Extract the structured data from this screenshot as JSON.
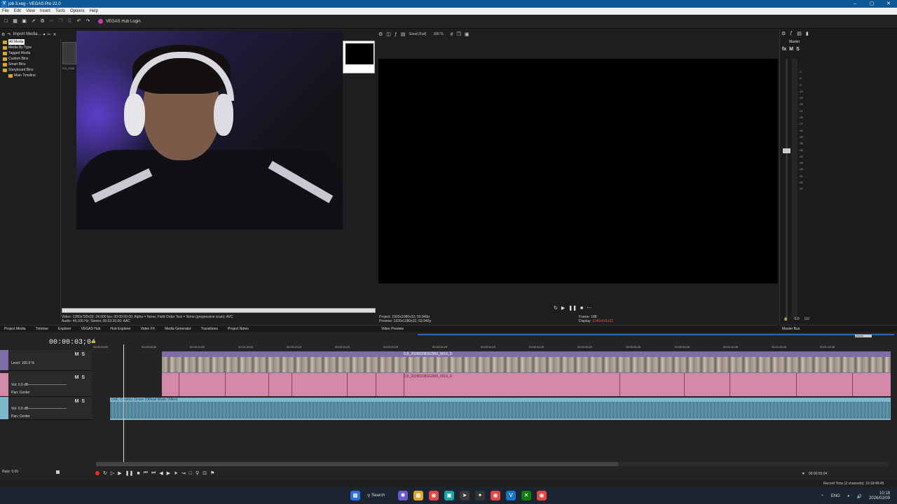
{
  "window": {
    "title": "job 3.veg - VEGAS Pro 22.0",
    "app_icon": "V"
  },
  "menu": [
    "File",
    "Edit",
    "View",
    "Insert",
    "Tools",
    "Options",
    "Help"
  ],
  "toolbar": {
    "hub_login": "VEGAS Hub Login"
  },
  "project_media": {
    "import_label": "Import Media...",
    "tree": [
      "All Media",
      "Media By Type",
      "Tagged Media",
      "Custom Bins",
      "Smart Bins",
      "Storyboard Bins",
      "Main Timeline"
    ],
    "thumb_label": "DJI_2026",
    "info_video": "Video: 1280x720x32; 24,000 fps; 00:00:00;00; Alpha = None; Field Order Test = None (progressive scan); AVC",
    "info_audio": "Audio: 44,100 Hz; Stereo; 00:03:30;00; AAC"
  },
  "bottom_tabs": [
    "Project Media",
    "Trimmer",
    "Explorer",
    "VEGAS Hub",
    "Hub Explorer",
    "Video FX",
    "Media Generator",
    "Transitions",
    "Project Notes"
  ],
  "preview": {
    "quality": "Good (Full)",
    "zoom": "100 %",
    "tab": "Video Preview",
    "project": "Project: 1920x1080x32; 59.940p",
    "preview_res": "Preview: 1920x1080x32; 59.940p",
    "frame_label": "Frame:",
    "frame_value": "188",
    "display_label": "Display:",
    "display_value": "1140x641x32"
  },
  "mixer": {
    "master": "Master",
    "buttons": [
      "fx",
      "M",
      "S"
    ],
    "scale": [
      "-3",
      "-6",
      "-9",
      "-12",
      "-15",
      "-18",
      "-21",
      "-24",
      "-27",
      "-30",
      "-33",
      "-36",
      "-39",
      "-42",
      "-45",
      "-48",
      "-51",
      "-54",
      "-57"
    ],
    "bottom_left": "0.0",
    "bottom_right": "0.0",
    "tab": "Master Bus"
  },
  "timeline": {
    "timecode": "00:00:03;04",
    "tracks": [
      {
        "level_label": "Level: 100.0 %",
        "m": "M",
        "s": "S"
      },
      {
        "vol_label": "Vol:",
        "vol": "0.0 dB",
        "pan_label": "Pan:",
        "pan": "Center",
        "m": "M",
        "s": "S"
      },
      {
        "vol_label": "Vol:",
        "vol": "0.0 dB",
        "pan_label": "Pan:",
        "pan": "Center",
        "m": "M",
        "s": "S"
      }
    ],
    "ruler": [
      "00:00:00;00",
      "00:00:05;00",
      "00:00:10;00",
      "00:00:15;00",
      "00:00:19;29",
      "00:00:24;29",
      "00:00:29;29",
      "00:00:34;29",
      "00:00:39;29",
      "00:00:44;29",
      "00:00:49;29",
      "00:00:54;28",
      "00:00:59;28",
      "00:01:04;28",
      "00:01:09;28",
      "00:01:14;28"
    ],
    "video_clip": "DJI_20260208162900_0016_D",
    "audio_clip": "OvE, Country, Grave (Official Music Video)",
    "end_badge": "+3:30;00",
    "rate": "Rate: 0.00",
    "cursor_time": "00:00:03;04",
    "record_time": "Record Time (2 channels): 10:18:48:45"
  },
  "taskbar": {
    "search": "Search",
    "lang": "ENG",
    "time": "10:18",
    "date": "2026/02/09"
  }
}
